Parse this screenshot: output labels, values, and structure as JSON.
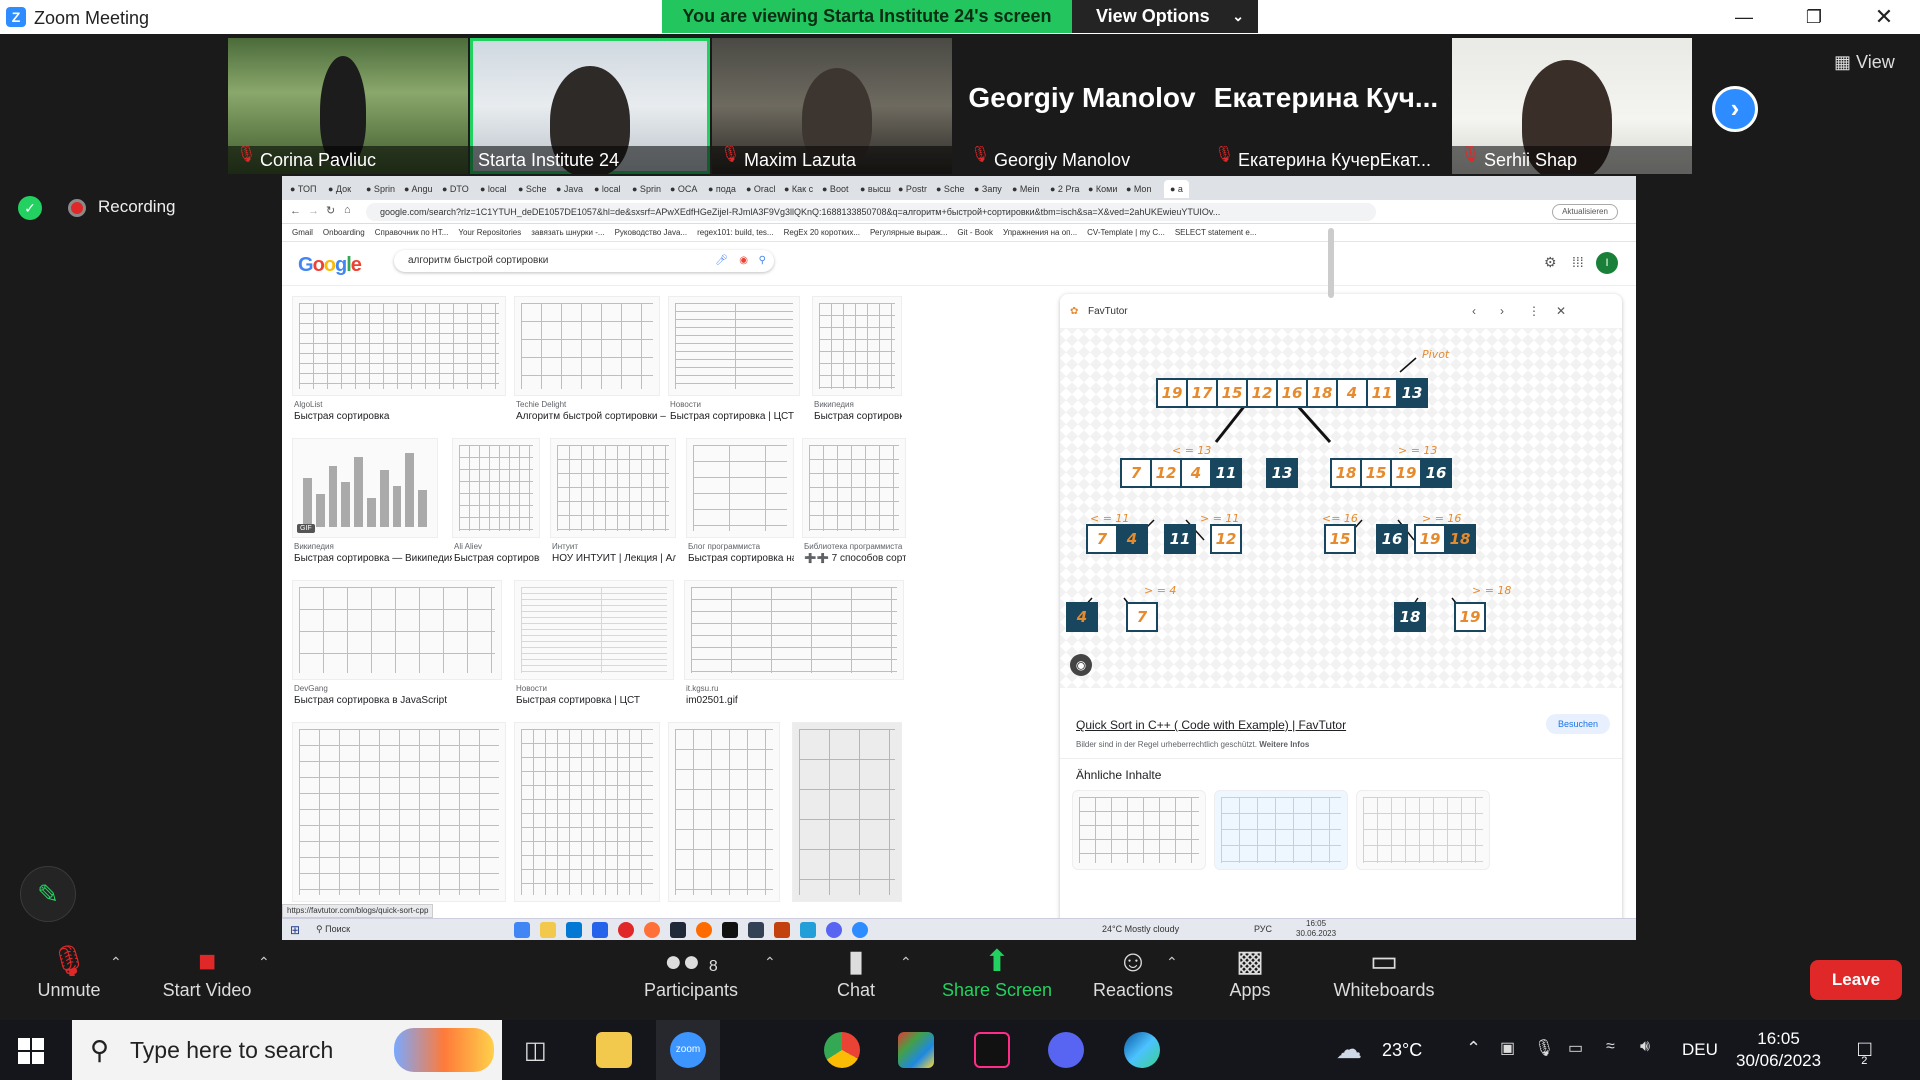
{
  "window": {
    "title": "Zoom Meeting",
    "app_icon": "Z"
  },
  "banner": {
    "viewing": "You are viewing Starta Institute 24's screen",
    "view_options": "View Options"
  },
  "gallery": {
    "tiles": [
      {
        "name": "Corina Pavliuc",
        "muted": true
      },
      {
        "name": "Starta Institute 24",
        "muted": false,
        "active": true
      },
      {
        "name": "Maxim Lazuta",
        "muted": true
      },
      {
        "name": "Georgiy Manolov",
        "muted": true,
        "display": "Georgiy Manolov"
      },
      {
        "name": "Екатерина КучерЕкат...",
        "muted": true,
        "display": "Екатерина  Куч..."
      },
      {
        "name": "Serhii Shap",
        "muted": true
      }
    ],
    "view_label": "View"
  },
  "status": {
    "recording": "Recording"
  },
  "shared": {
    "tabs": [
      "ТОП",
      "Док",
      "Sprin",
      "Angu",
      "DTO",
      "local",
      "Sche",
      "Java",
      "local",
      "Sprin",
      "OCA",
      "пода",
      "Oracl",
      "Как с",
      "Boot",
      "высш",
      "Postr",
      "Sche",
      "Запу",
      "Mein",
      "2 Pra",
      "Коми",
      "Mon",
      "а"
    ],
    "url": "google.com/search?rlz=1C1YTUH_deDE1057DE1057&hl=de&sxsrf=APwXEdfHGeZijeI-RJmlA3F9Vg3llQKnQ:1688133850708&q=алгоритм+быстрой+сортировки&tbm=isch&sa=X&ved=2ahUKEwieuYTUIOv...",
    "update_label": "Aktualisieren",
    "bookmarks": [
      "Gmail",
      "Onboarding",
      "Справочник по HT...",
      "Your Repositories",
      "завязать шнурки -...",
      "Руководство Java...",
      "regex101: build, tes...",
      "RegEx 20 коротких...",
      "Регулярные выраж...",
      "Git - Book",
      "Упражнения на оп...",
      "CV-Template | my C...",
      "SELECT statement e..."
    ],
    "google_logo": "Google",
    "search_query": "алгоритм быстрой сортировки",
    "avatar_letter": "I",
    "results": [
      {
        "src": "AlgoList",
        "cap": "Быстрая сортировка"
      },
      {
        "src": "Techie Delight",
        "cap": "Алгоритм быстрой сортировки – ре..."
      },
      {
        "src": "Новости",
        "cap": "Быстрая сортировка | ЦСТ"
      },
      {
        "src": "Википедия",
        "cap": "Быстрая сортировк..."
      },
      {
        "src": "Википедия",
        "cap": "Быстрая сортировка — Википедия"
      },
      {
        "src": "Ali Aliev",
        "cap": "Быстрая сортировк..."
      },
      {
        "src": "Интуит",
        "cap": "НОУ ИНТУИТ | Лекция | Алго..."
      },
      {
        "src": "Блог программиста",
        "cap": "Быстрая сортировка на ..."
      },
      {
        "src": "Библиотека программиста",
        "cap": "➕➕ 7 способов сорт..."
      },
      {
        "src": "DevGang",
        "cap": "Быстрая сортировка в JavaScript"
      },
      {
        "src": "Новости",
        "cap": "Быстрая сортировка | ЦСТ"
      },
      {
        "src": "it.kgsu.ru",
        "cap": "im02501.gif"
      }
    ],
    "gif_badge": "GIF",
    "panel": {
      "source": "FavTutor",
      "title": "Quick Sort in C++ ( Code with Example) | FavTutor",
      "visit": "Besuchen",
      "note": "Bilder sind in der Regel urheberrechtlich geschützt.",
      "note_link": "Weitere Infos",
      "similar": "Ähnliche Inhalte",
      "diagram": {
        "pivot_label": "Pivot",
        "row0": [
          "19",
          "17",
          "15",
          "12",
          "16",
          "18",
          "4",
          "11",
          "13"
        ],
        "left": [
          "7",
          "12",
          "4",
          "11"
        ],
        "mid": "13",
        "right": [
          "18",
          "15",
          "19",
          "16"
        ],
        "le13": "< = 13",
        "ge13": "> = 13",
        "le11": "< = 11",
        "ge11": "> = 11",
        "le16": "<= 16",
        "ge16": "> = 16",
        "ge4": "> = 4",
        "ge18": "> = 18",
        "l2a": [
          "7",
          "4"
        ],
        "l2b": "11",
        "l2c": "12",
        "r2a": "15",
        "r2b": "16",
        "r2c": [
          "19",
          "18"
        ],
        "l3a": "4",
        "l3b": "7",
        "r3a": "18",
        "r3b": "19"
      }
    },
    "status_url": "https://favtutor.com/blogs/quick-sort-cpp",
    "inner_taskbar": {
      "search": "Поиск",
      "weather": "24°C  Mostly cloudy",
      "lang": "РУС",
      "time": "16:05",
      "date": "30.06.2023"
    }
  },
  "controls": {
    "unmute": "Unmute",
    "start_video": "Start Video",
    "participants": "Participants",
    "participants_count": "8",
    "chat": "Chat",
    "share_screen": "Share Screen",
    "reactions": "Reactions",
    "apps": "Apps",
    "whiteboards": "Whiteboards",
    "leave": "Leave"
  },
  "taskbar": {
    "search_placeholder": "Type here to search",
    "temperature": "23°C",
    "language": "DEU",
    "time": "16:05",
    "date": "30/06/2023",
    "notifications": "2"
  },
  "colors": {
    "zoom_blue": "#2d8cff",
    "green": "#22c55e",
    "leave_red": "#e02828",
    "node_dark": "#17465e",
    "node_orange": "#e68a2e"
  }
}
